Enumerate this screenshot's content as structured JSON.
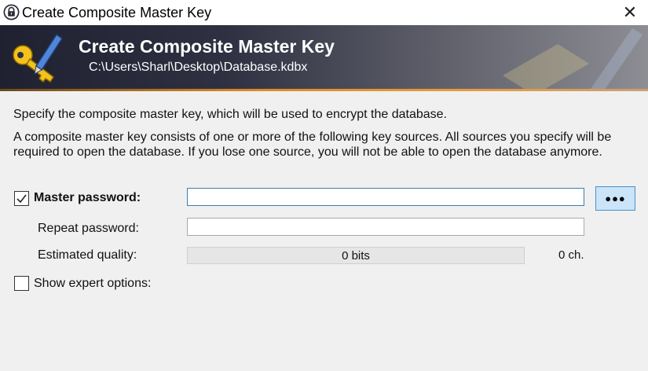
{
  "window": {
    "title": "Create Composite Master Key",
    "close_glyph": "✕"
  },
  "banner": {
    "heading": "Create Composite Master Key",
    "path": "C:\\Users\\Sharl\\Desktop\\Database.kdbx",
    "icon": "key-pen-icon"
  },
  "content": {
    "intro": "Specify the composite master key, which will be used to encrypt the database.",
    "description": "A composite master key consists of one or more of the following key sources. All sources you specify will be required to open the database. If you lose one source, you will not be able to open the database anymore."
  },
  "form": {
    "master_password": {
      "label": "Master password:",
      "checked": true,
      "value": "",
      "reveal_glyph": "●●●"
    },
    "repeat_password": {
      "label": "Repeat password:",
      "value": ""
    },
    "quality": {
      "label": "Estimated quality:",
      "bits_text": "0 bits",
      "chars_text": "0 ch.",
      "fill_fraction": 0
    },
    "expert_options": {
      "label": "Show expert options:",
      "checked": false
    }
  },
  "colors": {
    "banner_dark": "#1f2131",
    "accent_orange": "#e08a24",
    "focus_border": "#3c7fb1",
    "button_blue": "#cce4f7"
  }
}
